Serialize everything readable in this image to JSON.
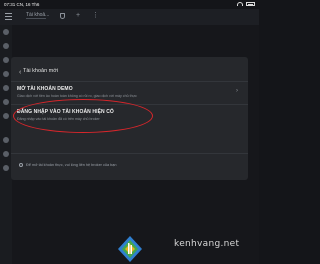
{
  "status_bar": {
    "time": "07:31 CN, 16 Th6"
  },
  "app_bar": {
    "account_label": "Tài khoả..."
  },
  "dialog": {
    "title": "Tài khoản mới",
    "options": [
      {
        "title": "MỞ TÀI KHOẢN DEMO",
        "description": "Giao dịch với tiền ảo hoàn toàn không có rủi ro, giao dịch với máy chủ thực",
        "highlighted": false
      },
      {
        "title": "ĐĂNG NHẬP VÀO TÀI KHOẢN HIỆN CÓ",
        "description": "Đăng nhập vào tài khoản đã có trên máy chủ broker",
        "highlighted": true
      }
    ],
    "note": "Để mở tài khoản thực, vui lòng liên hệ broker của bạn"
  },
  "watermark": "kenhvang.net",
  "colors": {
    "highlight_ring": "#d8262b",
    "sheet_bg": "#26282c",
    "page_bg": "#141519"
  }
}
